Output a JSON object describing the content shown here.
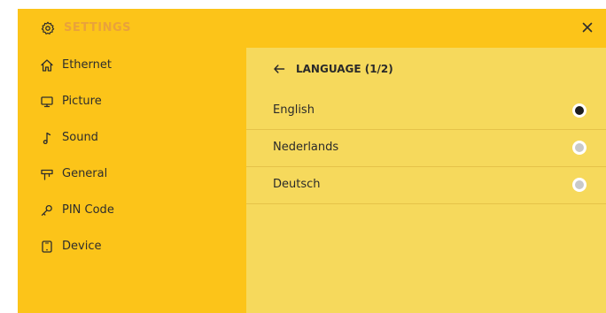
{
  "header": {
    "title": "SETTINGS",
    "settings_icon": "gear-icon",
    "close_icon": "close-icon"
  },
  "sidebar": {
    "items": [
      {
        "label": "Ethernet",
        "icon": "home-icon"
      },
      {
        "label": "Picture",
        "icon": "monitor-icon"
      },
      {
        "label": "Sound",
        "icon": "music-note-icon"
      },
      {
        "label": "General",
        "icon": "signpost-icon"
      },
      {
        "label": "PIN Code",
        "icon": "key-icon"
      },
      {
        "label": "Device",
        "icon": "device-icon"
      }
    ]
  },
  "content": {
    "back_icon": "arrow-left-icon",
    "title": "LANGUAGE (1/2)",
    "languages": [
      {
        "label": "English",
        "selected": true
      },
      {
        "label": "Nederlands",
        "selected": false
      },
      {
        "label": "Deutsch",
        "selected": false
      }
    ]
  },
  "colors": {
    "panel_bg": "#fcc419",
    "content_bg": "#f6d95c",
    "header_title": "#e9a23b",
    "radio_selected": "#1e1e1e",
    "radio_unselected": "#c9c9c9"
  }
}
